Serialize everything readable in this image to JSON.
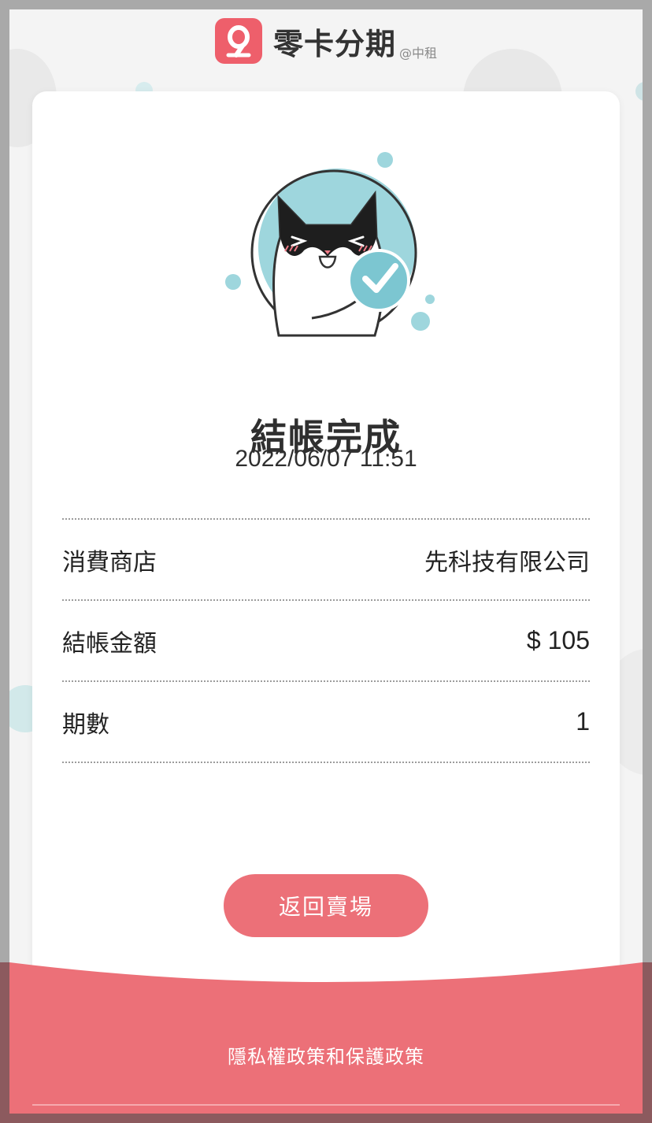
{
  "header": {
    "brand": "零卡分期",
    "brand_sub": "@中租",
    "logo_icon": "zingala-logo-icon"
  },
  "result": {
    "title": "結帳完成",
    "datetime": "2022/06/07 11:51",
    "illustration": "cat-thumbs-up-check-icon"
  },
  "details": [
    {
      "label": "消費商店",
      "value": "先科技有限公司"
    },
    {
      "label": "結帳金額",
      "value": "$ 105"
    },
    {
      "label": "期數",
      "value": "1"
    }
  ],
  "actions": {
    "return_label": "返回賣場"
  },
  "footer": {
    "privacy_link": "隱私權政策和保護政策"
  },
  "colors": {
    "accent": "#ec7078",
    "logo": "#ee5f6b",
    "teal": "#9ed6dd"
  }
}
